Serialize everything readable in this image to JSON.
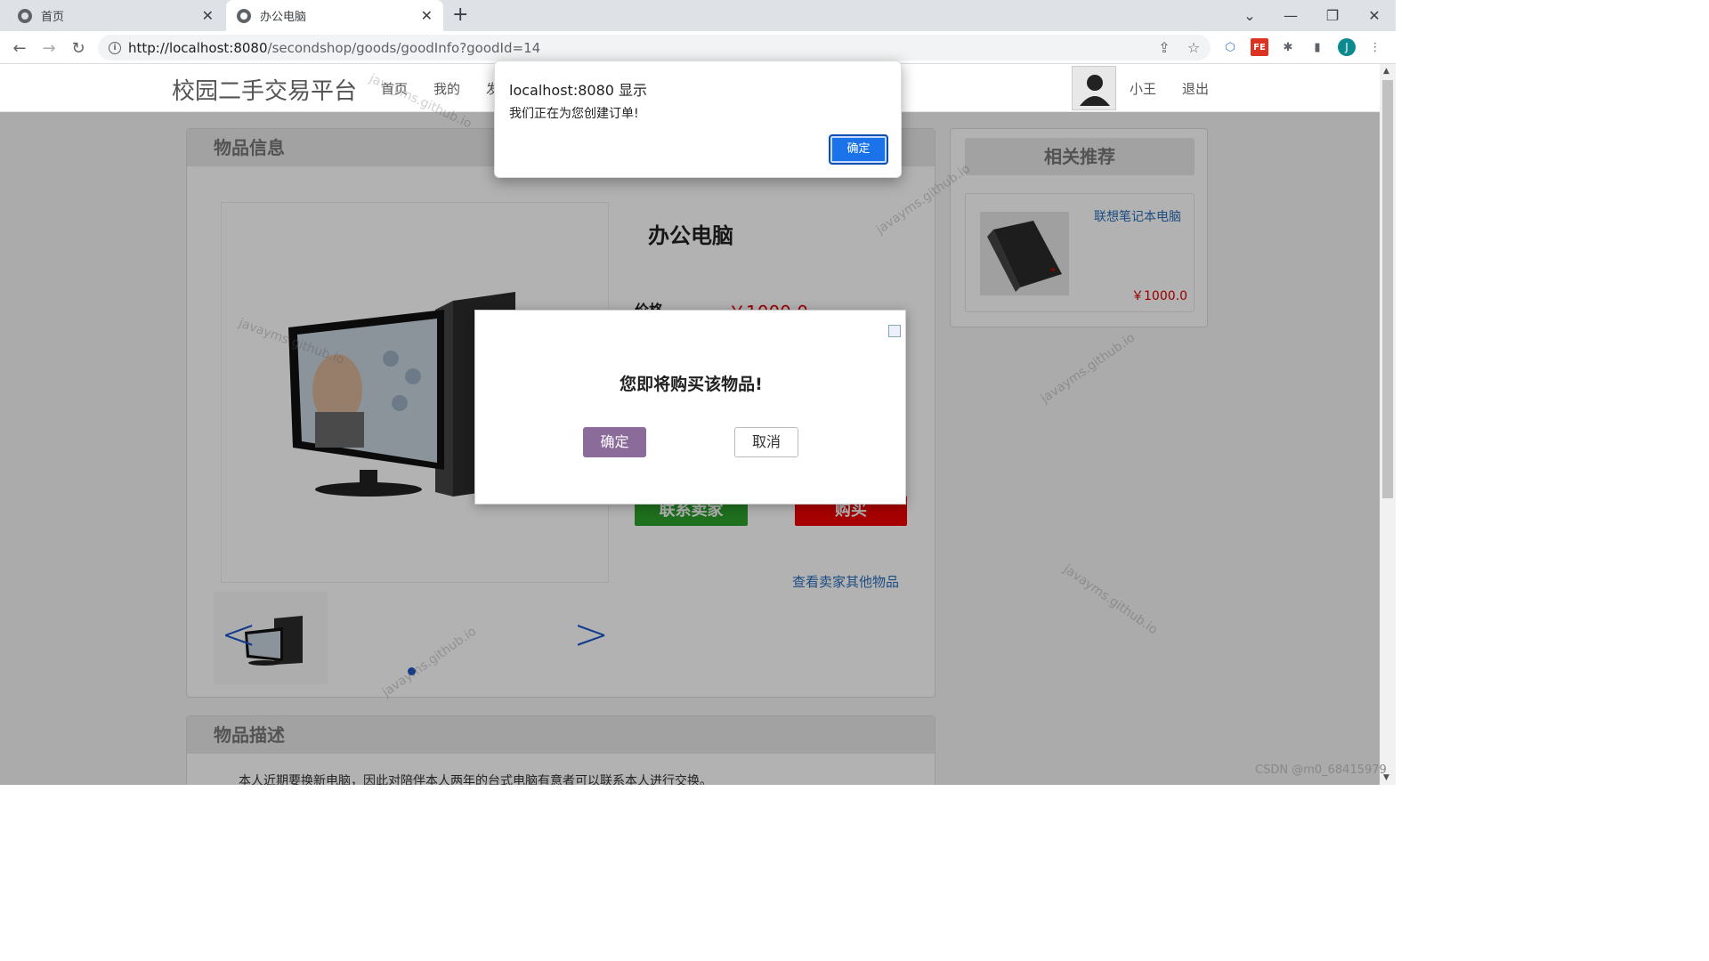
{
  "browser": {
    "tabs": [
      {
        "title": "首页",
        "active": false
      },
      {
        "title": "办公电脑",
        "active": true
      }
    ],
    "url_host": "http://localhost:8080",
    "url_path": "/secondshop/goods/goodInfo?goodId=14",
    "profile_initial": "J"
  },
  "site": {
    "logo": "校园二手交易平台",
    "nav": [
      "首页",
      "我的",
      "发"
    ],
    "user_name": "小王",
    "logout": "退出"
  },
  "goods_panel": {
    "header": "物品信息",
    "title": "办公电脑",
    "price_label": "价格",
    "price_value": "￥1000.0",
    "contact_button": "联系卖家",
    "buy_button": "购买",
    "seller_link": "查看卖家其他物品"
  },
  "recommend": {
    "header": "相关推荐",
    "items": [
      {
        "name": "联想笔记本电脑",
        "price": "￥1000.0"
      }
    ]
  },
  "description": {
    "header": "物品描述",
    "text": "本人近期要换新电脑，因此对陪伴本人两年的台式电脑有意者可以联系本人进行交换。"
  },
  "confirm_modal": {
    "message": "您即将购买该物品!",
    "ok_label": "确定",
    "cancel_label": "取消"
  },
  "alert": {
    "title": "localhost:8080 显示",
    "message": "我们正在为您创建订单!",
    "ok_label": "确定"
  },
  "watermark": "javayms.github.io",
  "footer_credit": "CSDN @m0_68415979"
}
